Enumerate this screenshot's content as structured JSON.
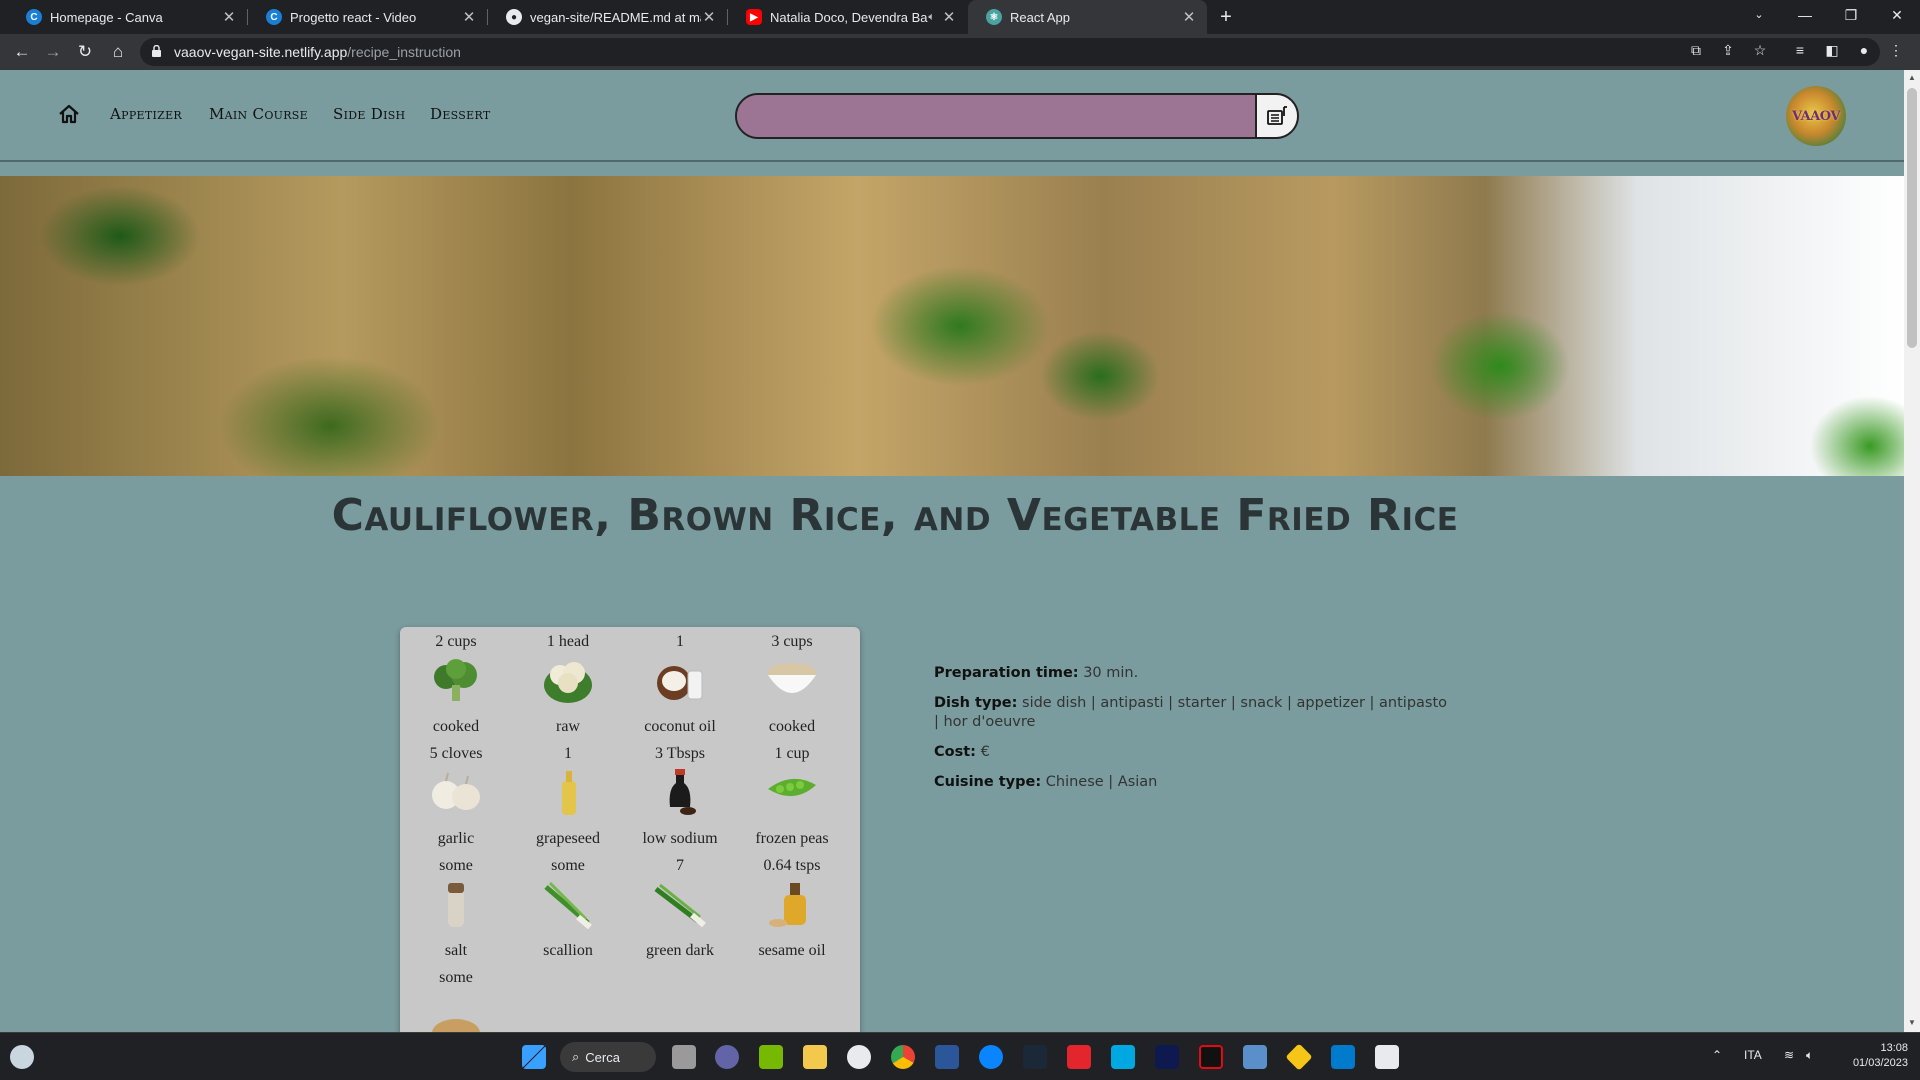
{
  "browser": {
    "tabs": [
      {
        "title": "Homepage - Canva",
        "icon": "canva-icon",
        "color": "#1b7fd6"
      },
      {
        "title": "Progetto react - Video",
        "icon": "canva-icon",
        "color": "#1b7fd6"
      },
      {
        "title": "vegan-site/README.md at main",
        "icon": "github-icon",
        "color": "#e8eaed"
      },
      {
        "title": "Natalia Doco, Devendra Banh",
        "icon": "youtube-icon",
        "color": "#ff0000"
      },
      {
        "title": "React App",
        "icon": "react-icon",
        "color": "#4aa3a0"
      }
    ],
    "active_tab": 4,
    "url_host": "vaaov-vegan-site.netlify.app",
    "url_path": "/recipe_instruction"
  },
  "site": {
    "nav": [
      "Appetizer",
      "Main Course",
      "Side Dish",
      "Dessert"
    ],
    "search": {
      "value": "",
      "placeholder": ""
    },
    "logo_text": "VAAOV"
  },
  "recipe": {
    "title": "Cauliflower, Brown Rice, and Vegetable Fried Rice",
    "ingredients": [
      {
        "qty": "2 cups",
        "name": "cooked",
        "icon": "broccoli-icon"
      },
      {
        "qty": "1 head",
        "name": "raw",
        "icon": "cauliflower-icon"
      },
      {
        "qty": "1",
        "name": "coconut oil",
        "icon": "coconut-icon"
      },
      {
        "qty": "3 cups",
        "name": "cooked",
        "icon": "rice-bowl-icon"
      },
      {
        "qty": "5 cloves",
        "name": "garlic",
        "icon": "garlic-icon"
      },
      {
        "qty": "1",
        "name": "grapeseed",
        "icon": "oil-bottle-icon"
      },
      {
        "qty": "3 Tbsps",
        "name": "low sodium",
        "icon": "soy-sauce-icon"
      },
      {
        "qty": "1 cup",
        "name": "frozen peas",
        "icon": "peas-icon"
      },
      {
        "qty": "some",
        "name": "salt",
        "icon": "salt-shaker-icon"
      },
      {
        "qty": "some",
        "name": "scallion",
        "icon": "scallion-icon"
      },
      {
        "qty": "7",
        "name": "green dark",
        "icon": "green-onion-icon"
      },
      {
        "qty": "0.64 tsps",
        "name": "sesame oil",
        "icon": "sesame-oil-icon"
      },
      {
        "qty": "some",
        "name": "",
        "icon": "sesame-seeds-icon"
      }
    ],
    "info": {
      "prep_label": "Preparation time:",
      "prep_value": "30 min.",
      "dish_label": "Dish type:",
      "dish_value": "side dish | antipasti | starter | snack | appetizer | antipasto | hor d'oeuvre",
      "cost_label": "Cost:",
      "cost_value": "€",
      "cuisine_label": "Cuisine type:",
      "cuisine_value": "Chinese | Asian"
    }
  },
  "taskbar": {
    "search_label": "Cerca",
    "lang": "ITA",
    "time": "13:08",
    "date": "01/03/2023"
  },
  "colors": {
    "page_bg": "#7a9c9e",
    "search_fill": "#9c7494",
    "ingredients_bg": "#c8c8c8"
  }
}
